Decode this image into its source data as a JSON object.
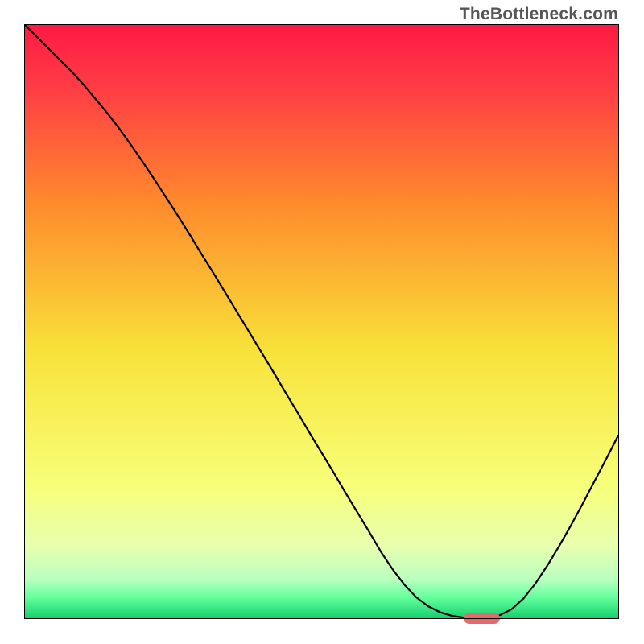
{
  "watermark": "TheBottleneck.com",
  "colors": {
    "gradient_top": "#ff1a44",
    "gradient_mid1": "#ff8a2c",
    "gradient_mid2": "#f8e23a",
    "gradient_mid3": "#f7ff7a",
    "gradient_bottom_band": "#63ff9c",
    "gradient_bottom": "#16d06e",
    "curve": "#000000",
    "marker": "#e46a6f",
    "axes": "#000000",
    "watermark_text": "#565656"
  },
  "chart_data": {
    "type": "line",
    "title": "",
    "xlabel": "",
    "ylabel": "",
    "xlim": [
      0,
      100
    ],
    "ylim": [
      0,
      100
    ],
    "x": [
      0,
      2,
      4,
      6,
      8,
      10,
      12,
      14,
      16,
      18,
      20,
      22,
      24,
      26,
      28,
      30,
      32,
      34,
      36,
      38,
      40,
      42,
      44,
      46,
      48,
      50,
      52,
      54,
      56,
      58,
      60,
      62,
      64,
      66,
      68,
      70,
      72,
      74,
      76,
      78,
      80,
      82,
      84,
      86,
      88,
      90,
      92,
      94,
      96,
      98,
      100
    ],
    "values": [
      100,
      98.0,
      96.0,
      94.0,
      92.0,
      89.8,
      87.4,
      85.0,
      82.4,
      79.6,
      76.7,
      73.7,
      70.6,
      67.5,
      64.3,
      61.0,
      57.8,
      54.5,
      51.2,
      47.9,
      44.6,
      41.3,
      37.9,
      34.6,
      31.2,
      27.9,
      24.6,
      21.2,
      17.9,
      14.6,
      11.2,
      8.2,
      5.6,
      3.5,
      2.0,
      1.0,
      0.4,
      0.1,
      0.0,
      0.1,
      0.5,
      1.5,
      3.3,
      5.8,
      8.8,
      12.1,
      15.6,
      19.3,
      23.1,
      26.9,
      30.8
    ],
    "marker": {
      "x_start": 74,
      "x_end": 80,
      "y": 0
    },
    "notes": "Curve depicts bottleneck severity (y, percent) across a sweep (x, percent). The optimum (zero bottleneck) sits around x≈77 where the small pink capsule marks the ideal range. No axis tick labels are visible; ranges are assumed 0–100."
  }
}
